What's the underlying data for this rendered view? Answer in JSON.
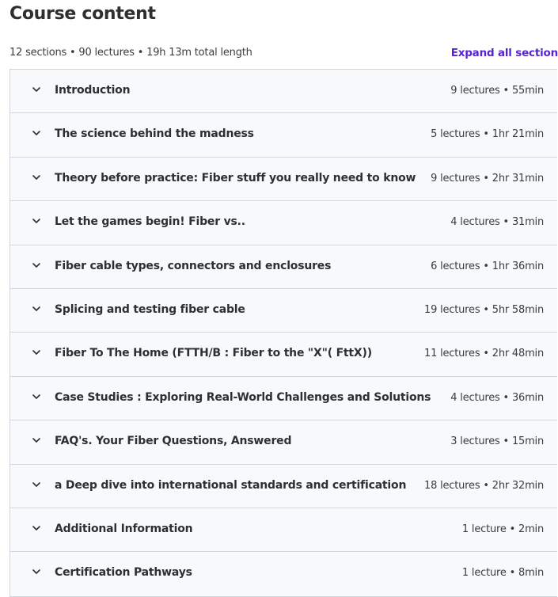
{
  "header": {
    "title": "Course content",
    "summary": "12 sections • 90 lectures • 19h 13m total length",
    "expand_label": "Expand all section"
  },
  "colors": {
    "accent": "#5624d0",
    "section_bg": "#f7f9fa",
    "border": "#d1d7dc",
    "text": "#2d2f31"
  },
  "sections": [
    {
      "title": "Introduction",
      "meta": "9 lectures • 55min",
      "icon": "chevron-down-icon"
    },
    {
      "title": "The science behind the madness",
      "meta": "5 lectures • 1hr 21min",
      "icon": "chevron-down-icon"
    },
    {
      "title": "Theory before practice: Fiber stuff you really need to know",
      "meta": "9 lectures • 2hr 31min",
      "icon": "chevron-down-icon"
    },
    {
      "title": "Let the games begin! Fiber vs..",
      "meta": "4 lectures • 31min",
      "icon": "chevron-down-icon"
    },
    {
      "title": "Fiber cable types, connectors and enclosures",
      "meta": "6 lectures • 1hr 36min",
      "icon": "chevron-down-icon"
    },
    {
      "title": "Splicing and testing fiber cable",
      "meta": "19 lectures • 5hr 58min",
      "icon": "chevron-down-icon"
    },
    {
      "title": "Fiber To The Home (FTTH/B : Fiber to the \"X\"( FttX))",
      "meta": "11 lectures • 2hr 48min",
      "icon": "chevron-down-icon"
    },
    {
      "title": "Case Studies : Exploring Real-World Challenges and Solutions",
      "meta": "4 lectures • 36min",
      "icon": "chevron-down-icon"
    },
    {
      "title": "FAQ's. Your Fiber Questions, Answered",
      "meta": "3 lectures • 15min",
      "icon": "chevron-down-icon"
    },
    {
      "title": "a Deep dive into international standards and certification",
      "meta": "18 lectures • 2hr 32min",
      "icon": "chevron-down-icon"
    },
    {
      "title": "Additional Information",
      "meta": "1 lecture • 2min",
      "icon": "chevron-down-icon"
    },
    {
      "title": "Certification Pathways",
      "meta": "1 lecture • 8min",
      "icon": "chevron-down-icon"
    }
  ]
}
